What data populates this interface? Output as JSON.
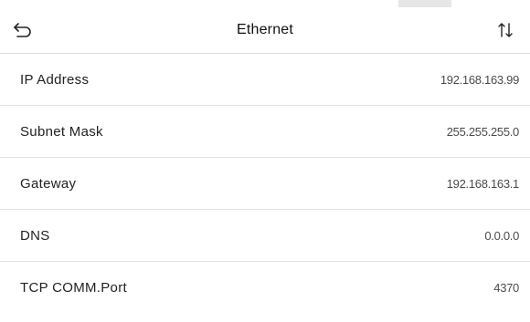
{
  "header": {
    "title": "Ethernet",
    "back_icon": "back-arrow-icon",
    "sort_icon": "sort-arrows-icon"
  },
  "settings": [
    {
      "label": "IP Address",
      "value": "192.168.163.99"
    },
    {
      "label": "Subnet Mask",
      "value": "255.255.255.0"
    },
    {
      "label": "Gateway",
      "value": "192.168.163.1"
    },
    {
      "label": "DNS",
      "value": "0.0.0.0"
    },
    {
      "label": "TCP COMM.Port",
      "value": "4370"
    }
  ],
  "colors": {
    "background": "#ffffff",
    "divider": "#e2e2e2",
    "text": "#222222",
    "value_text": "#4a4a4a"
  }
}
